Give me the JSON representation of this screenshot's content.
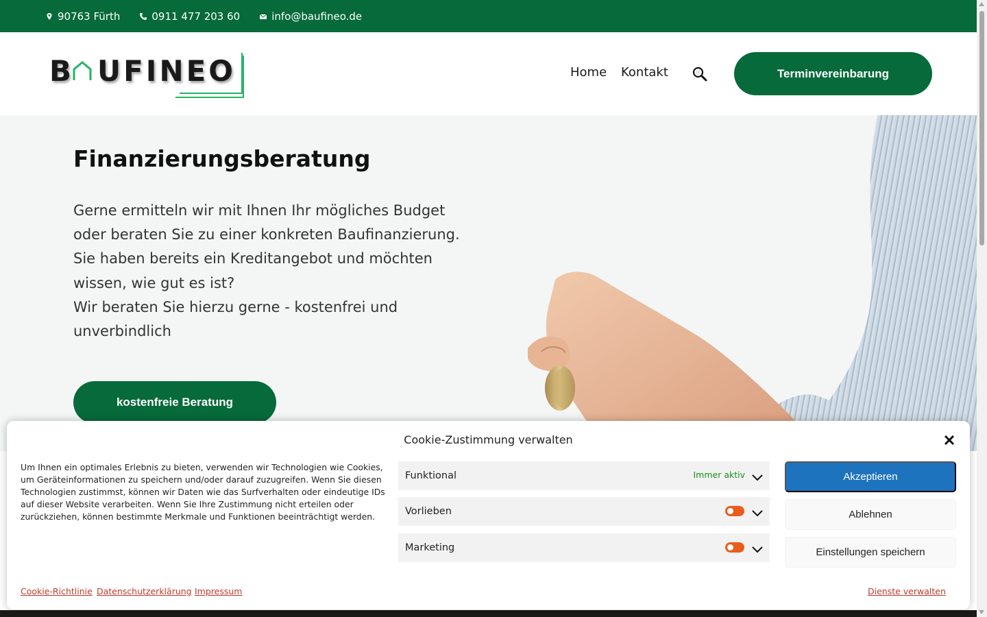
{
  "topbar": {
    "address": "90763 Fürth",
    "phone": "0911 477 203 60",
    "email": "info@baufineo.de",
    "bg_color": "#076a3b"
  },
  "header": {
    "logo_text": "BAUFINEO",
    "nav": {
      "home": "Home",
      "kontakt": "Kontakt"
    },
    "cta": "Terminvereinbarung"
  },
  "hero": {
    "title": "Finanzierungsberatung",
    "copy": [
      "Gerne ermitteln wir mit Ihnen Ihr mögliches Budget",
      "oder beraten Sie zu einer konkreten Baufinanzierung.",
      "Sie haben bereits ein Kreditangebot und möchten",
      "wissen, wie gut es ist?",
      "Wir beraten Sie hierzu gerne - kostenfrei und",
      "unverbindlich"
    ],
    "button": "kostenfreie Beratung"
  },
  "cookie": {
    "title": "Cookie-Zustimmung verwalten",
    "message": "Um Ihnen ein optimales Erlebnis zu bieten, verwenden wir Technologien wie Cookies, um Geräteinformationen zu speichern und/oder darauf zuzugreifen. Wenn Sie diesen Technologien zustimmst, können wir Daten wie das Surfverhalten oder eindeutige IDs auf dieser Website verarbeiten. Wenn Sie Ihre Zustimmung nicht erteilen oder zurückziehen, können bestimmte Merkmale und Funktionen beeinträchtigt werden.",
    "categories": [
      {
        "label": "Funktional",
        "status": "Immer aktiv"
      },
      {
        "label": "Vorlieben",
        "toggle_on": false
      },
      {
        "label": "Marketing",
        "toggle_on": false
      }
    ],
    "accept": "Akzeptieren",
    "deny": "Ablehnen",
    "save": "Einstellungen speichern",
    "links": {
      "policy": "Cookie-Richtlinie",
      "privacy": "Datenschutzerklärung",
      "imprint": "Impressum",
      "manage": "Dienste verwalten"
    },
    "accent_color": "#1e73be",
    "toggle_color": "#ea5c1c"
  }
}
